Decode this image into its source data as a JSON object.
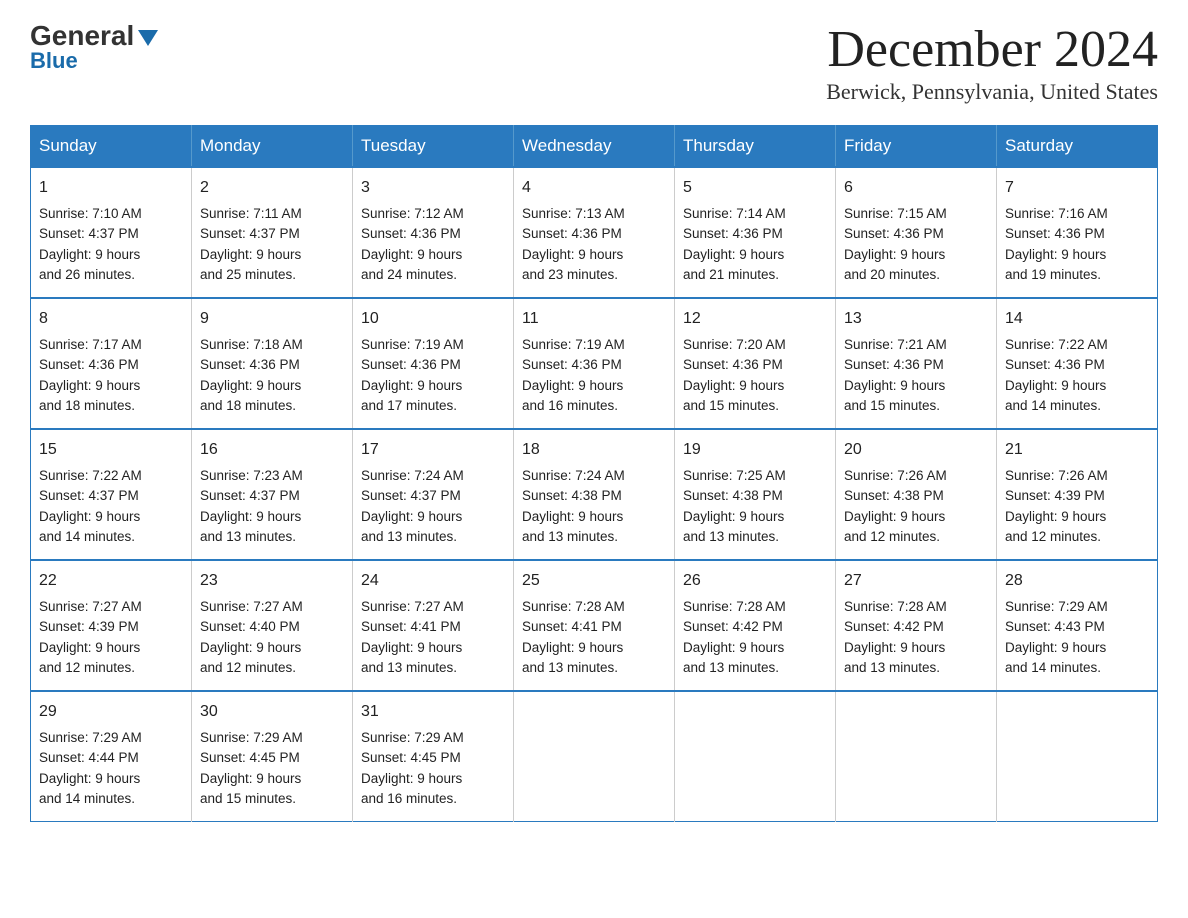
{
  "logo": {
    "general": "General",
    "blue": "Blue"
  },
  "header": {
    "title": "December 2024",
    "subtitle": "Berwick, Pennsylvania, United States"
  },
  "weekdays": [
    "Sunday",
    "Monday",
    "Tuesday",
    "Wednesday",
    "Thursday",
    "Friday",
    "Saturday"
  ],
  "weeks": [
    [
      {
        "day": "1",
        "sunrise": "7:10 AM",
        "sunset": "4:37 PM",
        "daylight": "9 hours and 26 minutes."
      },
      {
        "day": "2",
        "sunrise": "7:11 AM",
        "sunset": "4:37 PM",
        "daylight": "9 hours and 25 minutes."
      },
      {
        "day": "3",
        "sunrise": "7:12 AM",
        "sunset": "4:36 PM",
        "daylight": "9 hours and 24 minutes."
      },
      {
        "day": "4",
        "sunrise": "7:13 AM",
        "sunset": "4:36 PM",
        "daylight": "9 hours and 23 minutes."
      },
      {
        "day": "5",
        "sunrise": "7:14 AM",
        "sunset": "4:36 PM",
        "daylight": "9 hours and 21 minutes."
      },
      {
        "day": "6",
        "sunrise": "7:15 AM",
        "sunset": "4:36 PM",
        "daylight": "9 hours and 20 minutes."
      },
      {
        "day": "7",
        "sunrise": "7:16 AM",
        "sunset": "4:36 PM",
        "daylight": "9 hours and 19 minutes."
      }
    ],
    [
      {
        "day": "8",
        "sunrise": "7:17 AM",
        "sunset": "4:36 PM",
        "daylight": "9 hours and 18 minutes."
      },
      {
        "day": "9",
        "sunrise": "7:18 AM",
        "sunset": "4:36 PM",
        "daylight": "9 hours and 18 minutes."
      },
      {
        "day": "10",
        "sunrise": "7:19 AM",
        "sunset": "4:36 PM",
        "daylight": "9 hours and 17 minutes."
      },
      {
        "day": "11",
        "sunrise": "7:19 AM",
        "sunset": "4:36 PM",
        "daylight": "9 hours and 16 minutes."
      },
      {
        "day": "12",
        "sunrise": "7:20 AM",
        "sunset": "4:36 PM",
        "daylight": "9 hours and 15 minutes."
      },
      {
        "day": "13",
        "sunrise": "7:21 AM",
        "sunset": "4:36 PM",
        "daylight": "9 hours and 15 minutes."
      },
      {
        "day": "14",
        "sunrise": "7:22 AM",
        "sunset": "4:36 PM",
        "daylight": "9 hours and 14 minutes."
      }
    ],
    [
      {
        "day": "15",
        "sunrise": "7:22 AM",
        "sunset": "4:37 PM",
        "daylight": "9 hours and 14 minutes."
      },
      {
        "day": "16",
        "sunrise": "7:23 AM",
        "sunset": "4:37 PM",
        "daylight": "9 hours and 13 minutes."
      },
      {
        "day": "17",
        "sunrise": "7:24 AM",
        "sunset": "4:37 PM",
        "daylight": "9 hours and 13 minutes."
      },
      {
        "day": "18",
        "sunrise": "7:24 AM",
        "sunset": "4:38 PM",
        "daylight": "9 hours and 13 minutes."
      },
      {
        "day": "19",
        "sunrise": "7:25 AM",
        "sunset": "4:38 PM",
        "daylight": "9 hours and 13 minutes."
      },
      {
        "day": "20",
        "sunrise": "7:26 AM",
        "sunset": "4:38 PM",
        "daylight": "9 hours and 12 minutes."
      },
      {
        "day": "21",
        "sunrise": "7:26 AM",
        "sunset": "4:39 PM",
        "daylight": "9 hours and 12 minutes."
      }
    ],
    [
      {
        "day": "22",
        "sunrise": "7:27 AM",
        "sunset": "4:39 PM",
        "daylight": "9 hours and 12 minutes."
      },
      {
        "day": "23",
        "sunrise": "7:27 AM",
        "sunset": "4:40 PM",
        "daylight": "9 hours and 12 minutes."
      },
      {
        "day": "24",
        "sunrise": "7:27 AM",
        "sunset": "4:41 PM",
        "daylight": "9 hours and 13 minutes."
      },
      {
        "day": "25",
        "sunrise": "7:28 AM",
        "sunset": "4:41 PM",
        "daylight": "9 hours and 13 minutes."
      },
      {
        "day": "26",
        "sunrise": "7:28 AM",
        "sunset": "4:42 PM",
        "daylight": "9 hours and 13 minutes."
      },
      {
        "day": "27",
        "sunrise": "7:28 AM",
        "sunset": "4:42 PM",
        "daylight": "9 hours and 13 minutes."
      },
      {
        "day": "28",
        "sunrise": "7:29 AM",
        "sunset": "4:43 PM",
        "daylight": "9 hours and 14 minutes."
      }
    ],
    [
      {
        "day": "29",
        "sunrise": "7:29 AM",
        "sunset": "4:44 PM",
        "daylight": "9 hours and 14 minutes."
      },
      {
        "day": "30",
        "sunrise": "7:29 AM",
        "sunset": "4:45 PM",
        "daylight": "9 hours and 15 minutes."
      },
      {
        "day": "31",
        "sunrise": "7:29 AM",
        "sunset": "4:45 PM",
        "daylight": "9 hours and 16 minutes."
      },
      null,
      null,
      null,
      null
    ]
  ],
  "labels": {
    "sunrise": "Sunrise:",
    "sunset": "Sunset:",
    "daylight": "Daylight:"
  }
}
